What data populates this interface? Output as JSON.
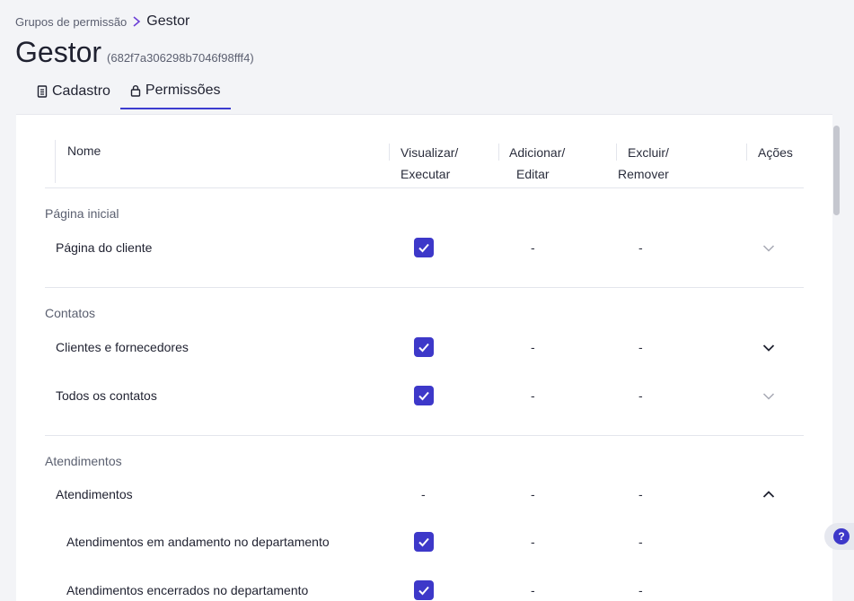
{
  "breadcrumb": {
    "parent": "Grupos de permissão",
    "current": "Gestor"
  },
  "header": {
    "title": "Gestor",
    "id": "(682f7a306298b7046f98fff4)"
  },
  "tabs": [
    {
      "label": "Cadastro",
      "icon": "document-icon",
      "active": false
    },
    {
      "label": "Permissões",
      "icon": "lock-icon",
      "active": true
    }
  ],
  "table": {
    "columns": {
      "name": "Nome",
      "view_1": "Visualizar/",
      "view_2": "Executar",
      "add_1": "Adicionar/",
      "add_2": "Editar",
      "del_1": "Excluir/",
      "del_2": "Remover",
      "actions": "Ações"
    },
    "sections": [
      {
        "label": "Página inicial",
        "rows": [
          {
            "label": "Página do cliente",
            "view": "checked",
            "add": "-",
            "del": "-",
            "chevron": "down-muted"
          }
        ]
      },
      {
        "label": "Contatos",
        "rows": [
          {
            "label": "Clientes e fornecedores",
            "view": "checked",
            "add": "-",
            "del": "-",
            "chevron": "down"
          },
          {
            "label": "Todos os contatos",
            "view": "checked",
            "add": "-",
            "del": "-",
            "chevron": "down-muted"
          }
        ]
      },
      {
        "label": "Atendimentos",
        "rows": [
          {
            "label": "Atendimentos",
            "view": "-",
            "add": "-",
            "del": "-",
            "chevron": "up"
          },
          {
            "label": "Atendimentos em andamento no departamento",
            "view": "checked",
            "add": "-",
            "del": "-",
            "chevron": "none"
          },
          {
            "label": "Atendimentos encerrados no departamento",
            "view": "checked",
            "add": "-",
            "del": "-",
            "chevron": "none"
          }
        ]
      }
    ]
  },
  "help": {
    "label": "?"
  },
  "colors": {
    "accent": "#3d38c9",
    "background": "#f3f4f7"
  }
}
